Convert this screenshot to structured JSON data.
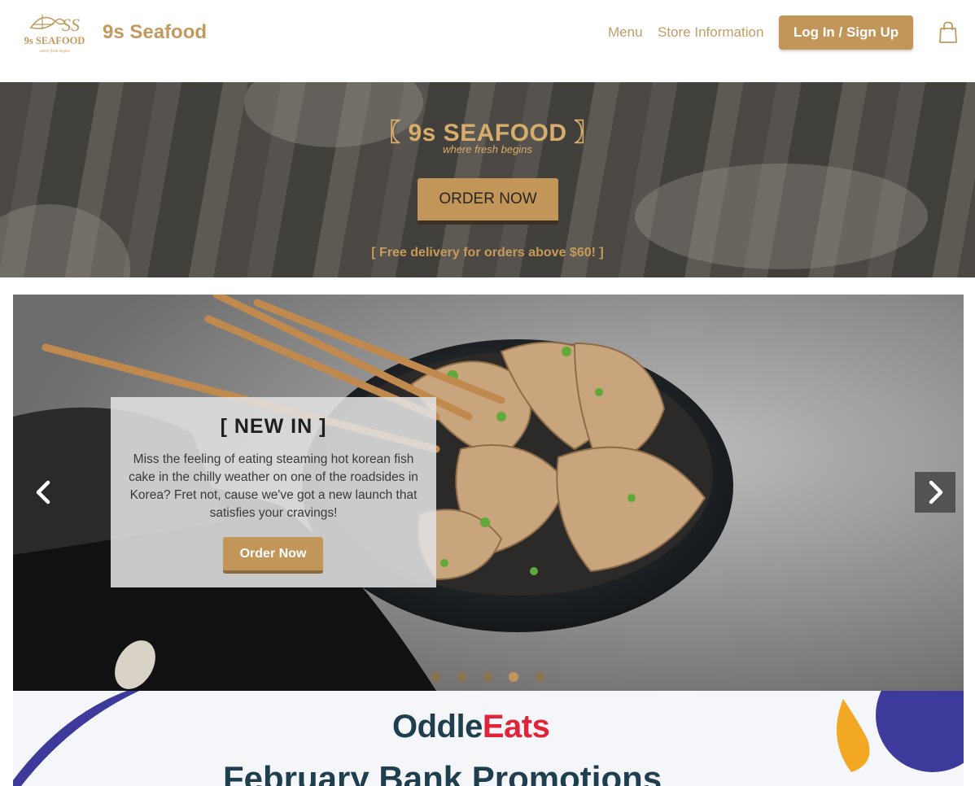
{
  "header": {
    "logo_alt": "9s SEAFOOD logo",
    "logo_text": "9s SEAFOOD",
    "logo_tagline": "where fresh begins",
    "brand_name": "9s Seafood",
    "nav": [
      {
        "label": "Menu"
      },
      {
        "label": "Store Information"
      }
    ],
    "login_label": "Log In / Sign Up",
    "cart_icon": "shopping-bag-icon"
  },
  "hero": {
    "title": "〖 9s SEAFOOD 〗",
    "subtitle": "where fresh begins",
    "cta_label": "ORDER NOW",
    "delivery_note": "[ Free delivery for orders above $60! ]"
  },
  "carousel": {
    "slide_title": "[ NEW IN ]",
    "slide_text": "Miss the feeling of eating steaming hot korean fish cake in the chilly weather on one of the roadsides in Korea? Fret not, cause we've got a new launch that satisfies your cravings!",
    "slide_cta": "Order Now",
    "prev_icon": "chevron-left-icon",
    "next_icon": "chevron-right-icon",
    "slide_count": 5,
    "active_slide": 4
  },
  "banner": {
    "brand_part1": "Oddle",
    "brand_part2": "Eats",
    "heading": "February Bank Promotions"
  },
  "colors": {
    "accent": "#c29558",
    "brand_text": "#c4995d",
    "oddle_dark": "#1f3f4f",
    "oddle_red": "#e2243a",
    "banner_purple": "#3e3a9b",
    "banner_yellow": "#f2a823"
  }
}
